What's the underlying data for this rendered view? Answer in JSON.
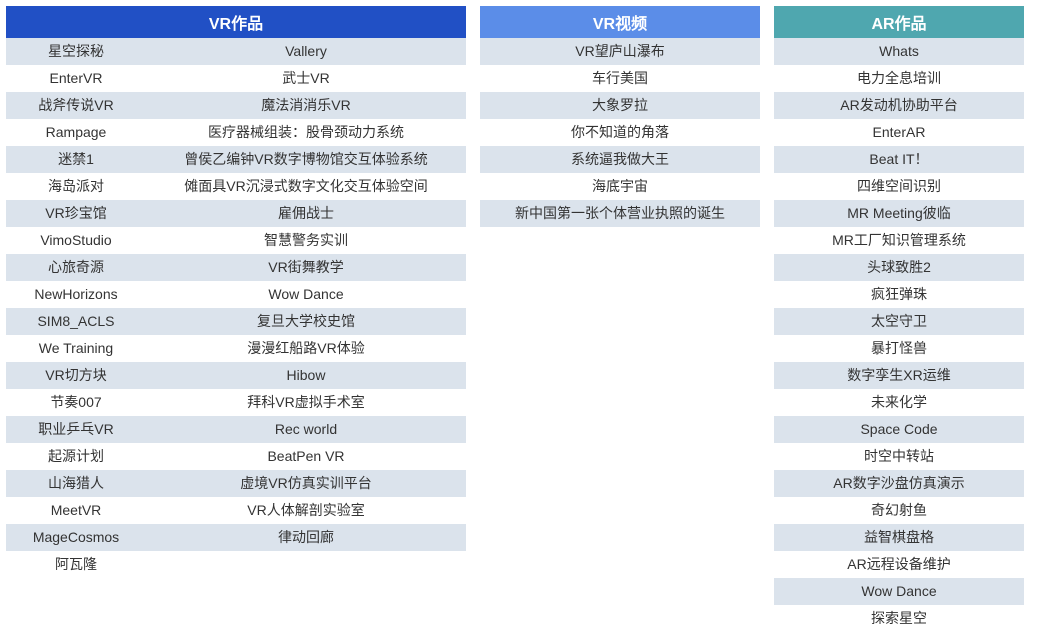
{
  "headers": {
    "vr": "VR作品",
    "video": "VR视频",
    "ar": "AR作品"
  },
  "vr": [
    [
      "星空探秘",
      "Vallery"
    ],
    [
      "EnterVR",
      "武士VR"
    ],
    [
      "战斧传说VR",
      "魔法消消乐VR"
    ],
    [
      "Rampage",
      "医疗器械组装：股骨颈动力系统"
    ],
    [
      "迷禁1",
      "曾侯乙编钟VR数字博物馆交互体验系统"
    ],
    [
      "海岛派对",
      "傩面具VR沉浸式数字文化交互体验空间"
    ],
    [
      "VR珍宝馆",
      "雇佣战士"
    ],
    [
      "VimoStudio",
      "智慧警务实训"
    ],
    [
      "心旅奇源",
      "VR街舞教学"
    ],
    [
      "NewHorizons",
      "Wow Dance"
    ],
    [
      "SIM8_ACLS",
      "复旦大学校史馆"
    ],
    [
      "We Training",
      "漫漫红船路VR体验"
    ],
    [
      "VR切方块",
      "Hibow"
    ],
    [
      "节奏007",
      "拜科VR虚拟手术室"
    ],
    [
      "职业乒乓VR",
      "Rec world"
    ],
    [
      "起源计划",
      "BeatPen VR"
    ],
    [
      "山海猎人",
      "虚境VR仿真实训平台"
    ],
    [
      "MeetVR",
      "VR人体解剖实验室"
    ],
    [
      "MageCosmos",
      "律动回廊"
    ],
    [
      "阿瓦隆",
      ""
    ]
  ],
  "video": [
    "VR望庐山瀑布",
    "车行美国",
    "大象罗拉",
    "你不知道的角落",
    "系统逼我做大王",
    "海底宇宙",
    "新中国第一张个体营业执照的诞生"
  ],
  "ar": [
    "Whats",
    "电力全息培训",
    "AR发动机协助平台",
    "EnterAR",
    "Beat IT！",
    "四维空间识别",
    "MR Meeting彼临",
    "MR工厂知识管理系统",
    "头球致胜2",
    "疯狂弹珠",
    "太空守卫",
    "暴打怪兽",
    "数字孪生XR运维",
    "未来化学",
    "Space Code",
    "时空中转站",
    "AR数字沙盘仿真演示",
    "奇幻射鱼",
    "益智棋盘格",
    "AR远程设备维护",
    "Wow Dance",
    "探索星空"
  ]
}
